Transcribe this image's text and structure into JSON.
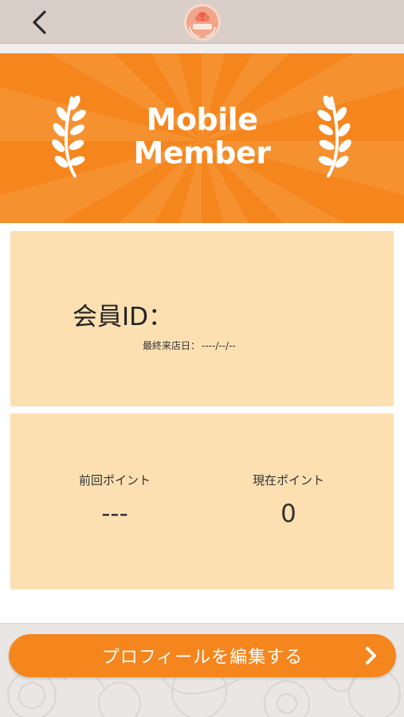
{
  "nav": {
    "back_icon": "chevron-left-icon",
    "logo_icon": "shop-logo-icon"
  },
  "banner": {
    "title_line1": "Mobile",
    "title_line2": "Member",
    "decoration_icon": "laurel-icon"
  },
  "member": {
    "id_label": "会員ID：",
    "id_value": "",
    "last_visit_label": "最終来店日：",
    "last_visit_value": "----/--/--"
  },
  "points": {
    "previous_label": "前回ポイント",
    "previous_value": "---",
    "current_label": "現在ポイント",
    "current_value": "0"
  },
  "actions": {
    "edit_profile_label": "プロフィールを編集する",
    "edit_profile_icon": "chevron-right-icon"
  },
  "colors": {
    "accent": "#f5851d",
    "card": "#fde0b2",
    "nav": "#d9cec8"
  }
}
